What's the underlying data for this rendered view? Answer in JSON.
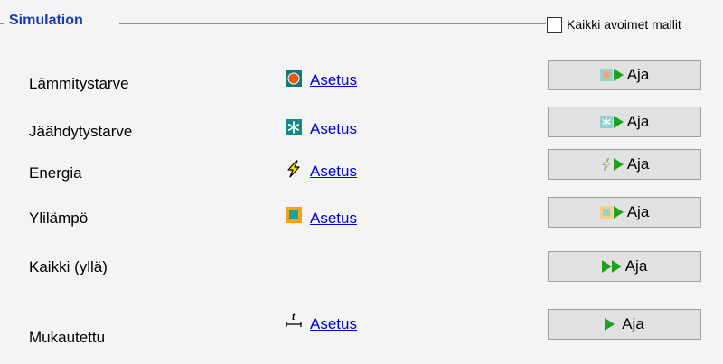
{
  "group": {
    "title": "Simulation"
  },
  "all_models": {
    "label": "Kaikki avoimet mallit",
    "checked": false
  },
  "rows": [
    {
      "label": "Lämmitystarve",
      "setting_label": "Asetus",
      "icon": "heating-icon",
      "run_label": "Aja"
    },
    {
      "label": "Jäähdytystarve",
      "setting_label": "Asetus",
      "icon": "cooling-icon",
      "run_label": "Aja"
    },
    {
      "label": "Energia",
      "setting_label": "Asetus",
      "icon": "energy-icon",
      "run_label": "Aja"
    },
    {
      "label": "Ylilämpö",
      "setting_label": "Asetus",
      "icon": "overheat-icon",
      "run_label": "Aja"
    },
    {
      "label": "Kaikki (yllä)",
      "run_label": "Aja"
    },
    {
      "label": "Mukautettu",
      "setting_label": "Asetus",
      "icon": "custom-time-icon",
      "run_label": "Aja"
    }
  ],
  "colors": {
    "title": "#1a39b5",
    "link": "#0000d8",
    "play": "#1fa11f",
    "button_bg": "#e1e1e1",
    "heating": "#e85a14",
    "cooling": "#0f8a8a",
    "overheat": "#f7a21b"
  }
}
